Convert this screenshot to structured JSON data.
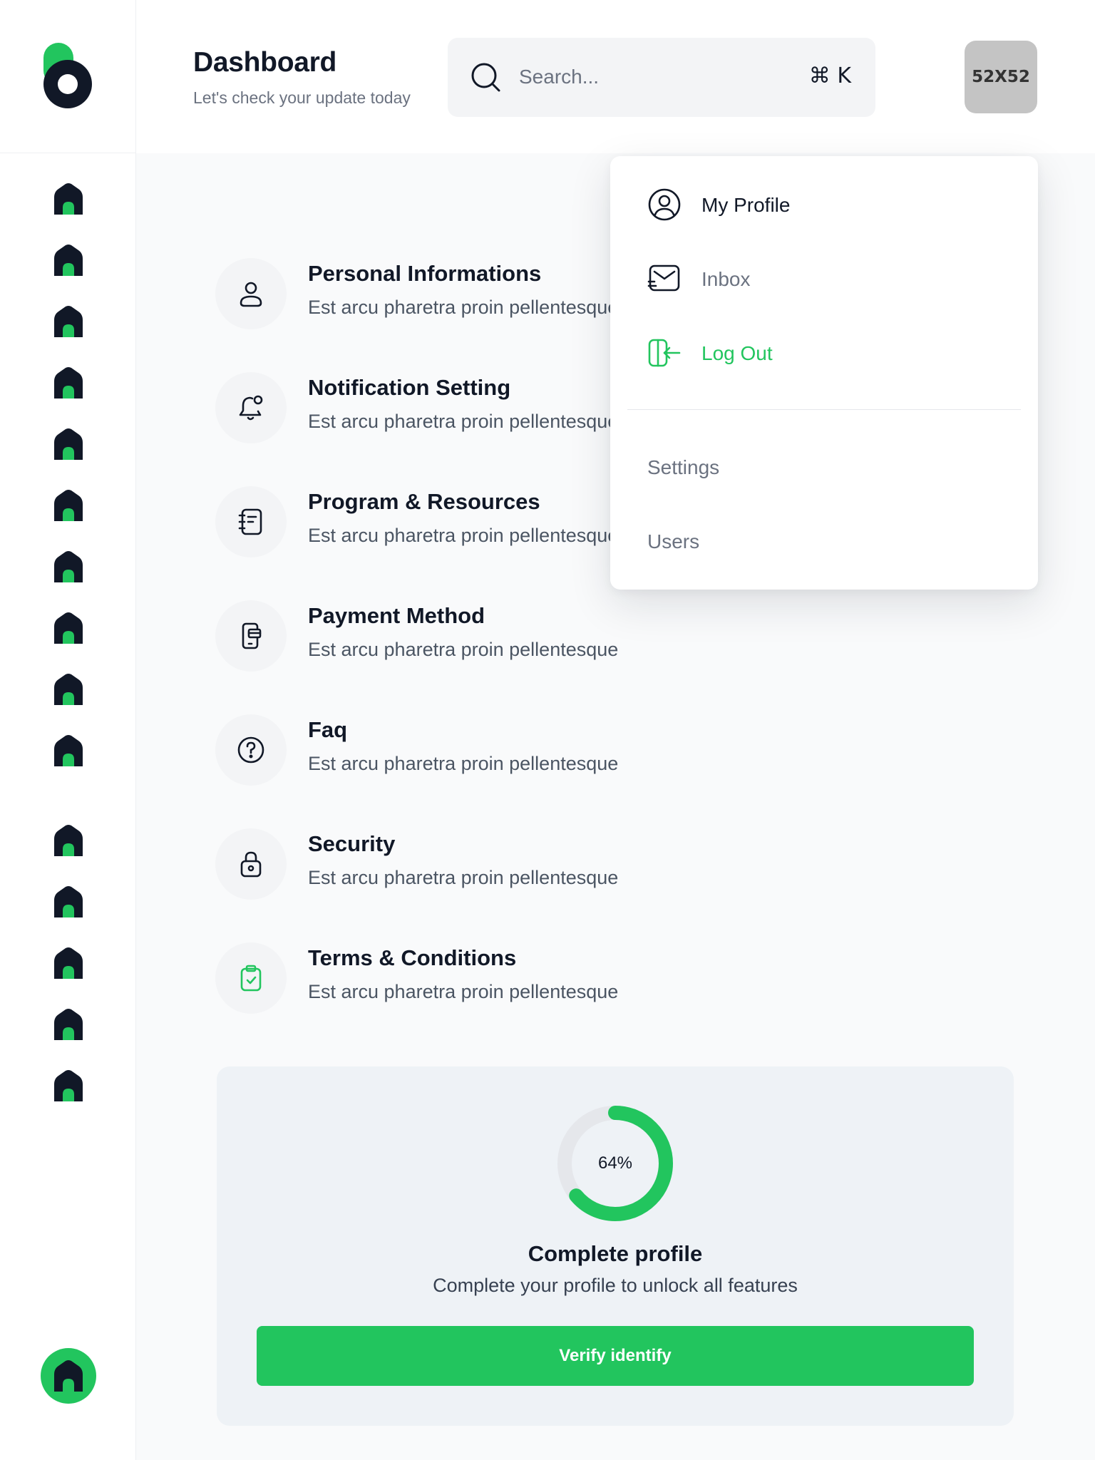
{
  "colors": {
    "accent": "#22c55e",
    "text_dark": "#111827",
    "text_muted": "#6b7280",
    "logout": "#22c55e"
  },
  "header": {
    "title": "Dashboard",
    "subtitle": "Let's check your update today",
    "search": {
      "placeholder": "Search...",
      "shortcut": "⌘ K",
      "icon": "search-icon"
    },
    "avatar_text": "52X52"
  },
  "sidebar": {
    "logo": "brand-logo",
    "items": [
      {
        "icon": "home-icon"
      },
      {
        "icon": "home-icon"
      },
      {
        "icon": "home-icon"
      },
      {
        "icon": "home-icon"
      },
      {
        "icon": "home-icon"
      },
      {
        "icon": "home-icon"
      },
      {
        "icon": "home-icon"
      },
      {
        "icon": "home-icon"
      },
      {
        "icon": "home-icon"
      },
      {
        "icon": "home-icon"
      },
      {
        "icon": "home-icon"
      },
      {
        "icon": "home-icon"
      },
      {
        "icon": "home-icon"
      },
      {
        "icon": "home-icon"
      },
      {
        "icon": "home-icon"
      }
    ],
    "active_item": {
      "icon": "home-icon"
    }
  },
  "menu": {
    "items": [
      {
        "title": "Personal Informations",
        "desc": "Est arcu pharetra proin pellentesque",
        "icon": "user-icon"
      },
      {
        "title": "Notification Setting",
        "desc": "Est arcu pharetra proin pellentesque",
        "icon": "bell-icon"
      },
      {
        "title": "Program & Resources",
        "desc": "Est arcu pharetra proin pellentesque",
        "icon": "notebook-icon"
      },
      {
        "title": "Payment Method",
        "desc": "Est arcu pharetra proin pellentesque",
        "icon": "phone-card-icon"
      },
      {
        "title": "Faq",
        "desc": "Est arcu pharetra proin pellentesque",
        "icon": "question-icon"
      },
      {
        "title": "Security",
        "desc": "Est arcu pharetra proin pellentesque",
        "icon": "lock-icon"
      },
      {
        "title": "Terms & Conditions",
        "desc": "Est arcu pharetra proin pellentesque",
        "icon": "clipboard-check-icon"
      }
    ]
  },
  "profile_card": {
    "progress_label": "64%",
    "progress_fraction": 0.64,
    "title": "Complete profile",
    "desc": "Complete your profile to unlock all features",
    "button": "Verify identify"
  },
  "dropdown": {
    "items": [
      {
        "label": "My Profile",
        "icon": "user-circle-icon"
      },
      {
        "label": "Inbox",
        "icon": "inbox-icon"
      },
      {
        "label": "Log Out",
        "icon": "logout-icon"
      }
    ],
    "secondary": [
      {
        "label": "Settings"
      },
      {
        "label": "Users"
      }
    ]
  }
}
